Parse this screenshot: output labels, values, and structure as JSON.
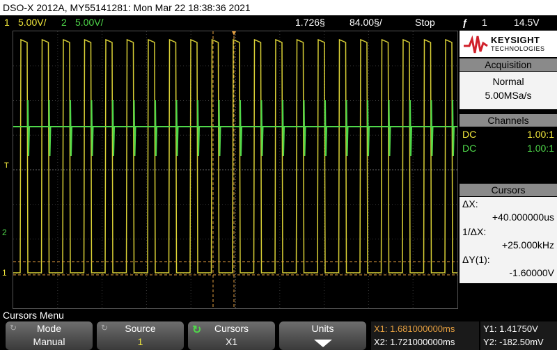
{
  "title_bar": "DSO-X 2012A, MY55141281: Mon Mar 22 18:38:36 2021",
  "status": {
    "ch1_num": "1",
    "ch1_scale": "5.00V/",
    "ch2_num": "2",
    "ch2_scale": "5.00V/",
    "time_pos": "1.726§",
    "time_scale": "84.00§/",
    "run_state": "Stop",
    "trigger_icon": "ƒ",
    "trigger_ch": "1",
    "trigger_level": "14.5V"
  },
  "colors": {
    "ch1": "#f2e83c",
    "ch2": "#4fd84a",
    "cursor": "#e6a040"
  },
  "markers": {
    "trigger": "T",
    "ch2": "2",
    "ch1": "1"
  },
  "panel": {
    "brand": "KEYSIGHT",
    "brand_sub": "TECHNOLOGIES",
    "acquisition_title": "Acquisition",
    "acq_mode": "Normal",
    "acq_rate": "5.00MSa/s",
    "channels_title": "Channels",
    "channels": [
      {
        "coupling": "DC",
        "probe": "1.00:1"
      },
      {
        "coupling": "DC",
        "probe": "1.00:1"
      }
    ],
    "cursors_title": "Cursors",
    "dx_label": "ΔX:",
    "dx_value": "+40.000000us",
    "inv_dx_label": "1/ΔX:",
    "inv_dx_value": "+25.000kHz",
    "dy_label": "ΔY(1):",
    "dy_value": "-1.60000V"
  },
  "menu_label": "Cursors Menu",
  "softkeys": [
    {
      "title": "Mode",
      "value": "Manual"
    },
    {
      "title": "Source",
      "value": "1"
    },
    {
      "title": "Cursors",
      "value": "X1"
    },
    {
      "title": "Units",
      "value": ""
    }
  ],
  "readout": {
    "x1": "X1: 1.681000000ms",
    "x2": "X2: 1.721000000ms",
    "y1": "Y1: 1.41750V",
    "y2": "Y2: -182.50mV"
  }
}
